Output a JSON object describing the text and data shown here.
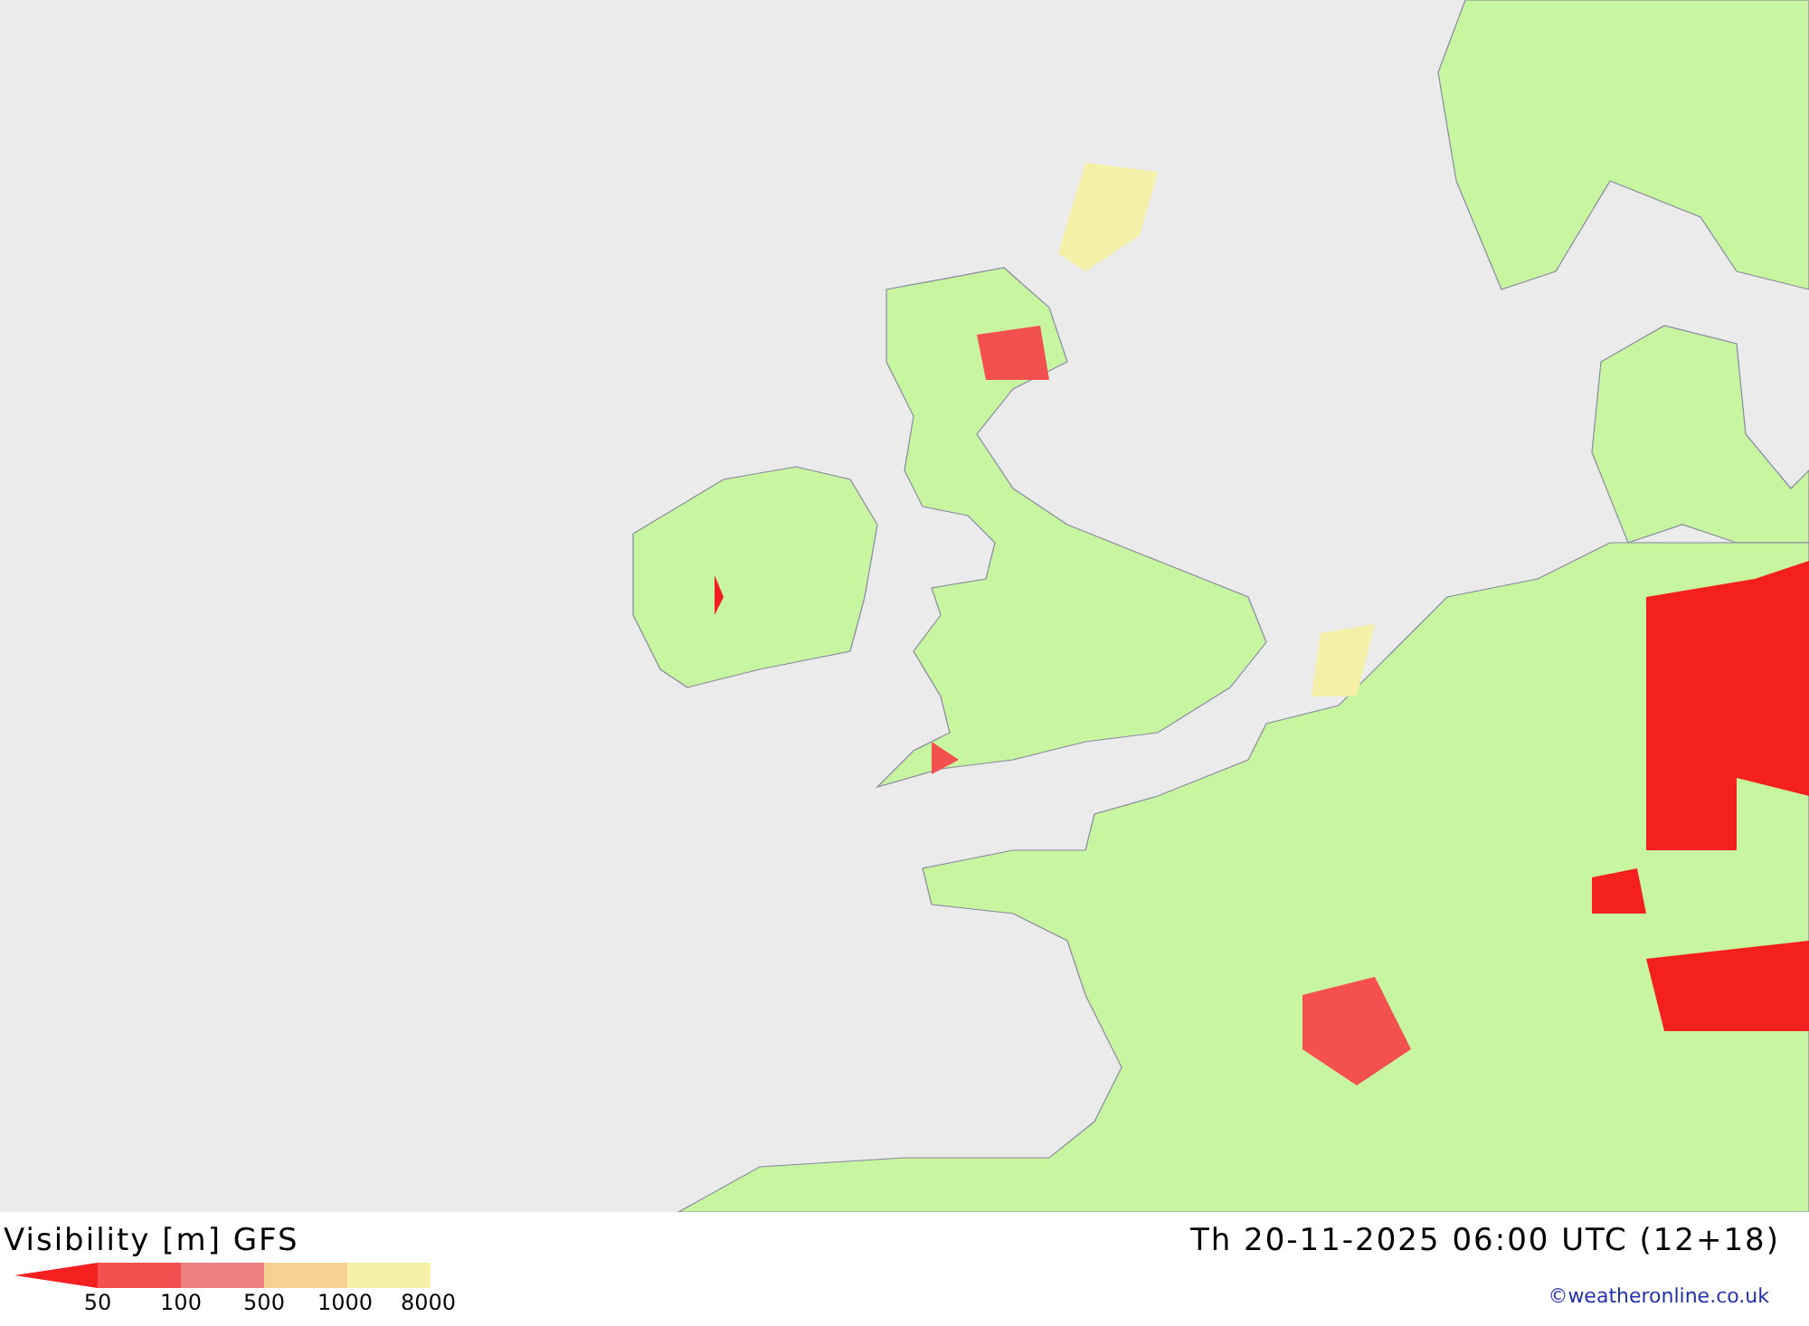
{
  "map": {
    "title": "Visibility [m]",
    "model": "GFS",
    "valid_time": "Th 20-11-2025 06:00 UTC (12+18)"
  },
  "legend": [
    {
      "label": "50",
      "color": "#f42020",
      "kind": "arrow"
    },
    {
      "label": "100",
      "color": "#f45050",
      "kind": "block"
    },
    {
      "label": "500",
      "color": "#f08080",
      "kind": "block"
    },
    {
      "label": "1000",
      "color": "#f5d090",
      "kind": "block"
    },
    {
      "label": "8000",
      "color": "#f5f0a8",
      "kind": "block"
    }
  ],
  "credit": "©weatheronline.co.uk"
}
